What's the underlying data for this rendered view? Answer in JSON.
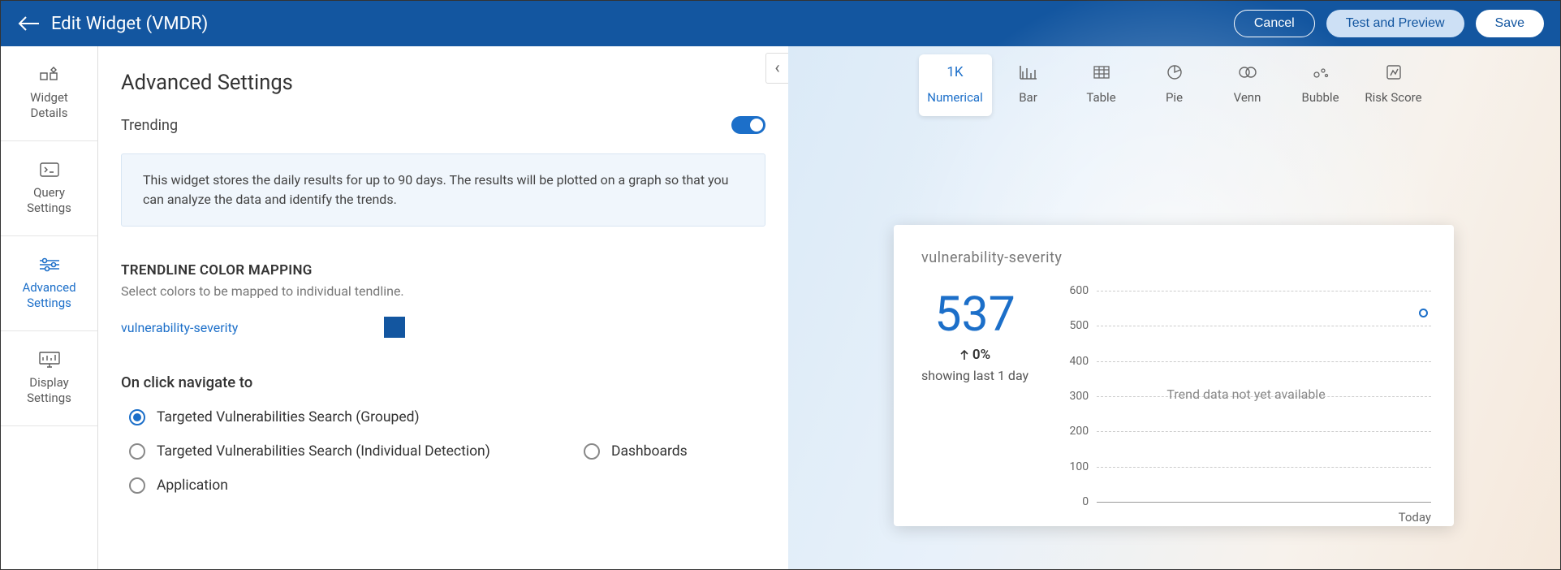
{
  "header": {
    "title": "Edit Widget (VMDR)",
    "cancel": "Cancel",
    "test_preview": "Test and Preview",
    "save": "Save"
  },
  "sidebar": {
    "items": [
      {
        "label": "Widget\nDetails"
      },
      {
        "label": "Query\nSettings"
      },
      {
        "label": "Advanced\nSettings"
      },
      {
        "label": "Display\nSettings"
      }
    ]
  },
  "settings": {
    "title": "Advanced Settings",
    "trending_label": "Trending",
    "trending_info": "This widget stores the daily results for up to 90 days. The results will be plotted on a graph so that you can analyze the data and identify the trends.",
    "color_mapping_title": "TRENDLINE COLOR MAPPING",
    "color_mapping_desc": "Select colors to be mapped to individual tendline.",
    "mapping_label": "vulnerability-severity",
    "mapping_color": "#1356a0",
    "nav_title": "On click navigate to",
    "radio_options": {
      "grouped": "Targeted Vulnerabilities Search (Grouped)",
      "individual": "Targeted Vulnerabilities Search (Individual Detection)",
      "dashboards": "Dashboards",
      "application": "Application"
    }
  },
  "chart_types": [
    {
      "label": "Numerical",
      "icon_text": "1K"
    },
    {
      "label": "Bar"
    },
    {
      "label": "Table"
    },
    {
      "label": "Pie"
    },
    {
      "label": "Venn"
    },
    {
      "label": "Bubble"
    },
    {
      "label": "Risk Score"
    }
  ],
  "preview": {
    "card_title": "vulnerability-severity",
    "value": "537",
    "change": "0%",
    "subtitle": "showing last 1 day",
    "trend_msg": "Trend data not yet available",
    "x_label": "Today"
  },
  "chart_data": {
    "type": "line",
    "title": "vulnerability-severity",
    "x": [
      "Today"
    ],
    "series": [
      {
        "name": "vulnerability-severity",
        "values": [
          537
        ]
      }
    ],
    "ylabel": "",
    "xlabel": "",
    "ylim": [
      0,
      600
    ],
    "y_ticks": [
      0,
      100,
      200,
      300,
      400,
      500,
      600
    ],
    "note": "Trend data not yet available"
  }
}
